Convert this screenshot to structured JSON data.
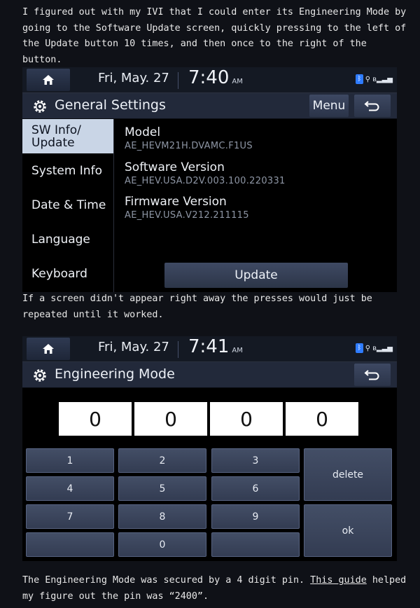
{
  "intro_text": "I figured out with my IVI that I could enter its Engineering Mode by going to the Software Update screen, quickly pressing to the left of the Update button 10 times, and then once to the right of the button.",
  "middle_text": "If a screen didn't appear right away the presses would just be repeated until it worked.",
  "footer": {
    "text_before": "The Engineering Mode was secured by a 4 digit pin. ",
    "link": "This guide",
    "text_after": " helped my figure out the pin was “2400”."
  },
  "colors": {
    "bluetooth": "#2f7cff",
    "active_sidebar": "#c9d5e6"
  },
  "screen1": {
    "date": "Fri, May. 27",
    "time": "7:40",
    "ampm": "AM",
    "title": "General Settings",
    "menu_label": "Menu",
    "sidebar": [
      {
        "label": "SW Info/\nUpdate",
        "active": true
      },
      {
        "label": "System Info",
        "active": false
      },
      {
        "label": "Date & Time",
        "active": false
      },
      {
        "label": "Language",
        "active": false
      },
      {
        "label": "Keyboard",
        "active": false
      }
    ],
    "info": [
      {
        "label": "Model",
        "value": "AE_HEVM21H.DVAMC.F1US"
      },
      {
        "label": "Software Version",
        "value": "AE_HEV.USA.D2V.003.100.220331"
      },
      {
        "label": "Firmware Version",
        "value": "AE_HEV.USA.V212.211115"
      }
    ],
    "update_label": "Update"
  },
  "screen2": {
    "date": "Fri, May. 27",
    "time": "7:41",
    "ampm": "AM",
    "title": "Engineering Mode",
    "pin": [
      "0",
      "0",
      "0",
      "0"
    ],
    "keys": [
      "1",
      "2",
      "3",
      "4",
      "5",
      "6",
      "7",
      "8",
      "9",
      "",
      "0",
      ""
    ],
    "delete_label": "delete",
    "ok_label": "ok"
  },
  "icons": [
    "home-icon",
    "gear-icon",
    "back-icon",
    "bluetooth-icon",
    "phone-icon",
    "signal-icon"
  ]
}
